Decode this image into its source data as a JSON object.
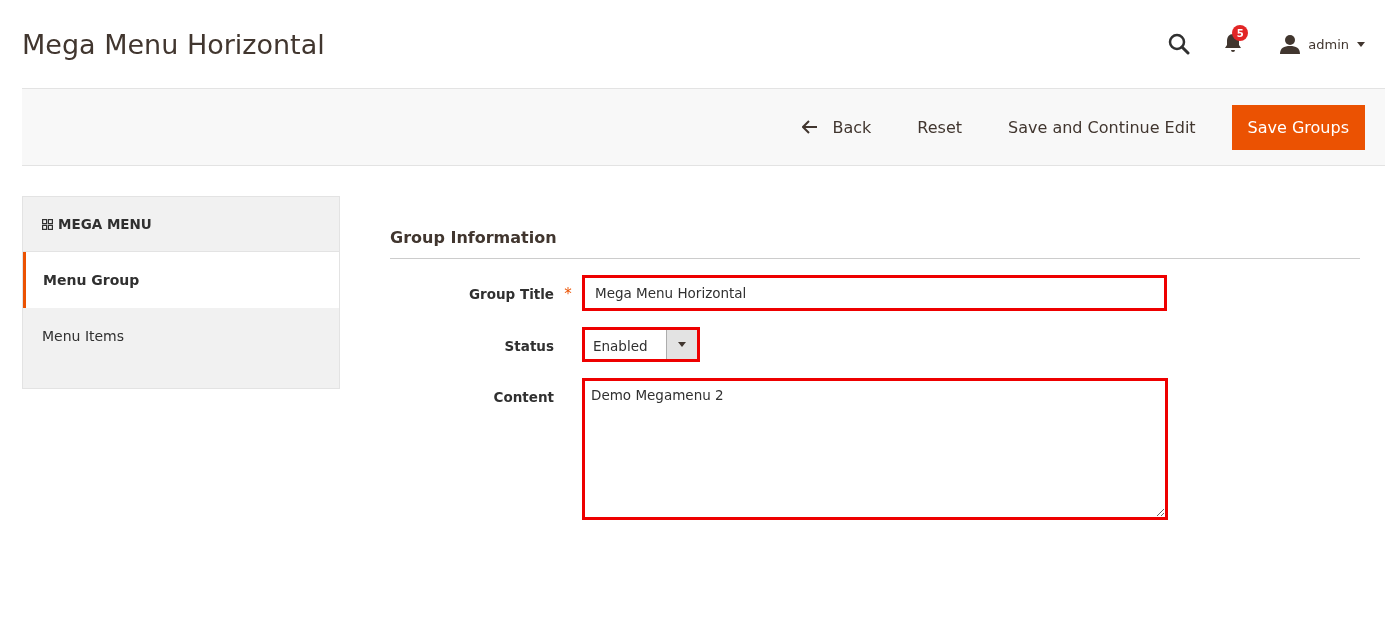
{
  "page_title": "Mega Menu Horizontal",
  "header": {
    "notification_count": "5",
    "user": "admin"
  },
  "actions": [
    {
      "kind": "back",
      "label": "Back"
    },
    {
      "kind": "plain",
      "label": "Reset"
    },
    {
      "kind": "plain",
      "label": "Save and Continue Edit"
    },
    {
      "kind": "primary",
      "label": "Save Groups"
    }
  ],
  "sidebar": {
    "title": "MEGA MENU",
    "items": [
      {
        "label": "Menu Group",
        "selected": true
      },
      {
        "label": "Menu Items",
        "selected": false
      }
    ]
  },
  "section_title": "Group Information",
  "fields": [
    {
      "kind": "text",
      "label": "Group Title",
      "required_mark": "*",
      "value": "Mega Menu Horizontal"
    },
    {
      "kind": "select",
      "label": "Status",
      "value": "Enabled"
    },
    {
      "kind": "textarea",
      "label": "Content",
      "value": "Demo Megamenu 2"
    }
  ]
}
